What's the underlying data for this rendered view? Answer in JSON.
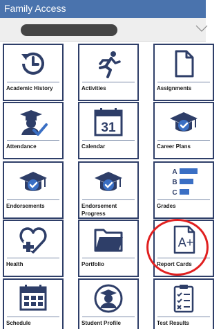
{
  "header": {
    "title": "Family Access"
  },
  "selector": {
    "chevron_icon": "chevron-down-icon"
  },
  "colors": {
    "header_bg": "#4a73ad",
    "icon_dark": "#2e3e68",
    "icon_blue": "#3a6fc4",
    "highlight": "#e02020"
  },
  "tiles": [
    {
      "label": "Academic History",
      "icon": "history-clock-icon"
    },
    {
      "label": "Activities",
      "icon": "running-person-icon"
    },
    {
      "label": "Assignments",
      "icon": "document-icon"
    },
    {
      "label": "Attendance",
      "icon": "graduate-check-icon"
    },
    {
      "label": "Calendar",
      "icon": "calendar-icon",
      "day": "31"
    },
    {
      "label": "Career Plans",
      "icon": "cap-check-icon"
    },
    {
      "label": "Endorsements",
      "icon": "cap-check-icon"
    },
    {
      "label": "Endorsement Progress",
      "icon": "cap-check-icon"
    },
    {
      "label": "Grades",
      "icon": "grade-bars-icon",
      "letters": [
        "A",
        "B",
        "C"
      ]
    },
    {
      "label": "Health",
      "icon": "heart-plus-icon"
    },
    {
      "label": "Portfolio",
      "icon": "folder-icon"
    },
    {
      "label": "Report Cards",
      "icon": "report-card-icon",
      "glyph": "A+"
    },
    {
      "label": "Schedule",
      "icon": "schedule-icon"
    },
    {
      "label": "Student Profile",
      "icon": "student-profile-icon"
    },
    {
      "label": "Test Results",
      "icon": "test-checklist-icon"
    }
  ]
}
